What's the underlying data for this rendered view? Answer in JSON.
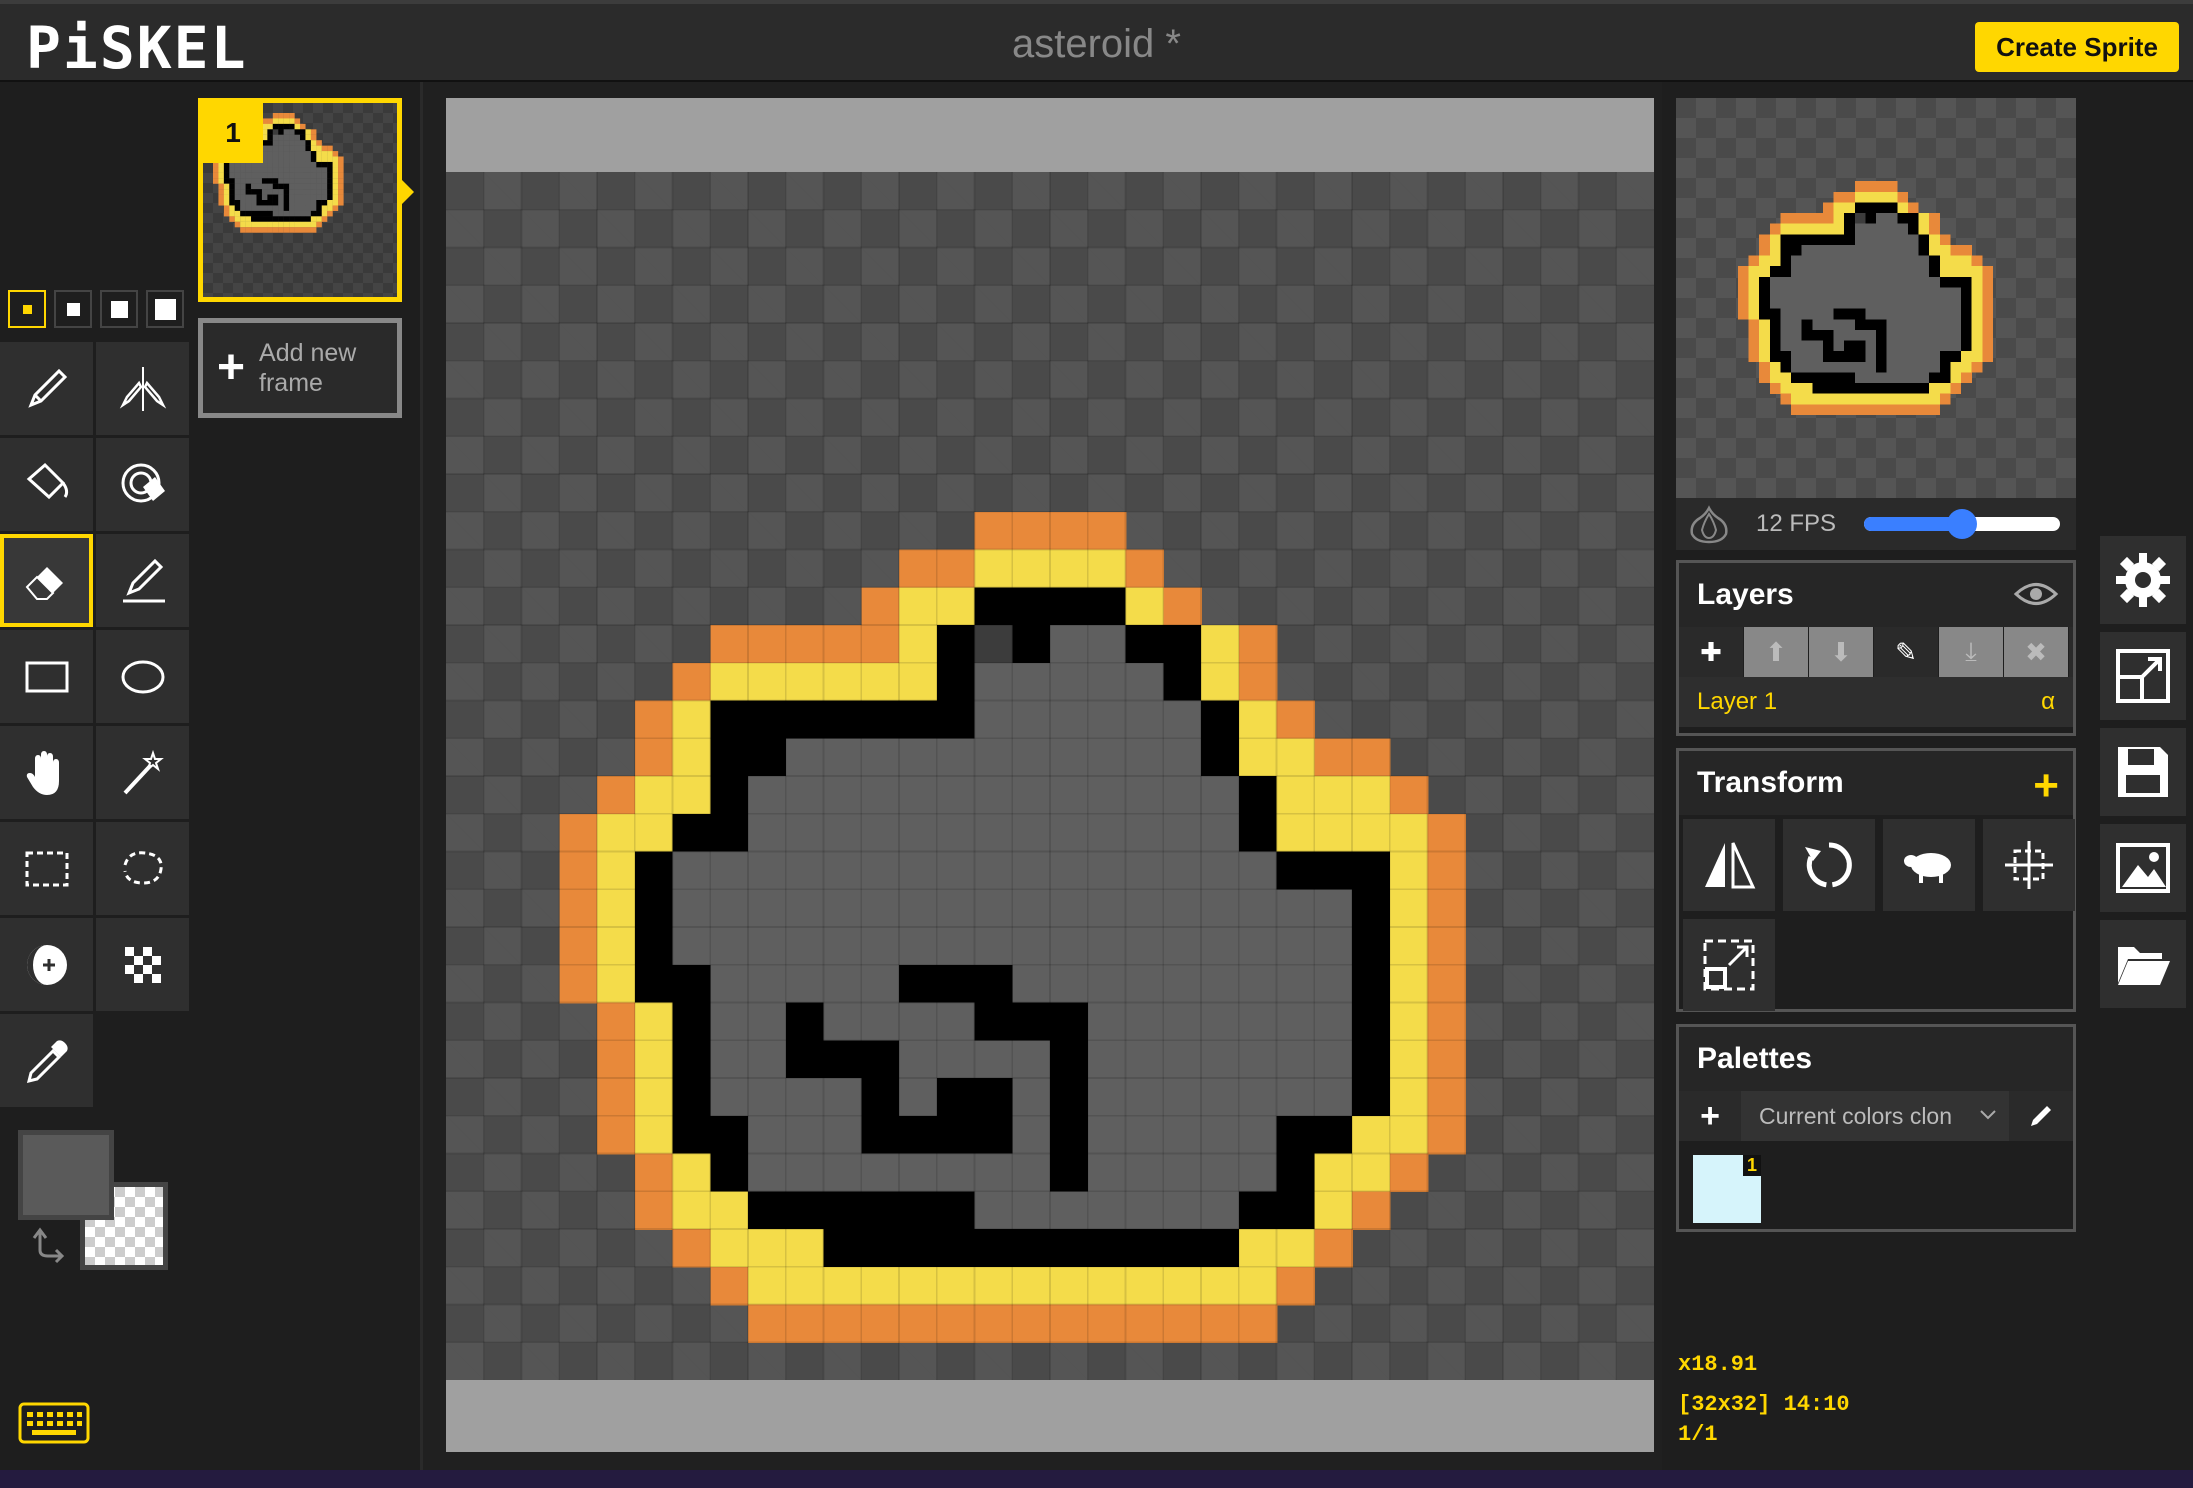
{
  "app": {
    "logo": "PiSKEL",
    "document_title": "asteroid *",
    "create_button": "Create Sprite"
  },
  "tools": {
    "pen_sizes": [
      "1",
      "2",
      "3",
      "4"
    ],
    "items": [
      "pen-icon",
      "vertical-mirror-pen-icon",
      "paint-bucket-icon",
      "paint-all-same-color-icon",
      "eraser-icon",
      "stroke-line-icon",
      "rectangle-icon",
      "ellipse-icon",
      "move-hand-icon",
      "shape-selection-wand-icon",
      "rectangle-selection-icon",
      "lasso-selection-icon",
      "lighten-darken-icon",
      "dithering-icon",
      "color-picker-icon"
    ],
    "active": "eraser-icon",
    "primary_color": "#5a5a5a",
    "secondary_color": "transparent"
  },
  "frames": {
    "items": [
      {
        "number": "1"
      }
    ],
    "add_label": "Add new frame"
  },
  "preview": {
    "fps": "12 FPS",
    "fps_value": 12,
    "fps_max": 24
  },
  "layers": {
    "title": "Layers",
    "items": [
      {
        "name": "Layer 1",
        "alpha": "α"
      }
    ]
  },
  "transform": {
    "title": "Transform"
  },
  "palettes": {
    "title": "Palettes",
    "selected": "Current colors clon",
    "swatch_count": "1",
    "swatch_color": "#d6f4fb"
  },
  "status": {
    "zoom": "x18.91",
    "size_pos": "[32x32] 14:10",
    "frame": "1/1"
  },
  "sprite_colors": {
    "orange": "#e8893a",
    "yellow": "#f4dc4a",
    "black": "#000000",
    "gray": "#5f5f5f",
    "darkgray": "#3c3c3c"
  },
  "sprite_rows": [
    "...........OOOO.................",
    ".........OOYYYYO................",
    "........OYYKKKKYO...............",
    "....OOOOOYKDKGGKKYO.............",
    "...OYYYYYYKGGGGGKYO.............",
    "..OYKKKKKKKGGGGGGKYO............",
    "..OYKKGGGGGGGGGGGKYYOO..........",
    ".OYYKGGGGGGGGGGGGGKYYYO.........",
    "OYYKKGGGGGGGGGGGGGKYYYYO........",
    "OYKGGGGGGGGGGGGGGGGKKKYO........",
    "OYKGGGGGGGGGGGGGGGGGGKYO........",
    "OYKGGGGGGGGGGGGGGGGGGKYO........",
    "OYKKGGGGGKKKGGGGGGGGGKYO........",
    ".OYKGGKGGGGKKKGGGGGGGKYO........",
    ".OYKGGKKKGGGGKGGGGGGGKYO........",
    ".OYKGGGGKGKKGKGGGGGGGKYO........",
    ".OYKKGGGKKKKGKGGGGGKKYYO........",
    "..OYKGGGGGGGGKGGGGGKYYO.........",
    "..OYYKKKKKKGGGGGGGKKYO..........",
    "...OYYYKKKKKKKKKKKYYO...........",
    "....OYYYYYYYYYYYYYYO............",
    ".....OOOOOOOOOOOOOO............."
  ]
}
